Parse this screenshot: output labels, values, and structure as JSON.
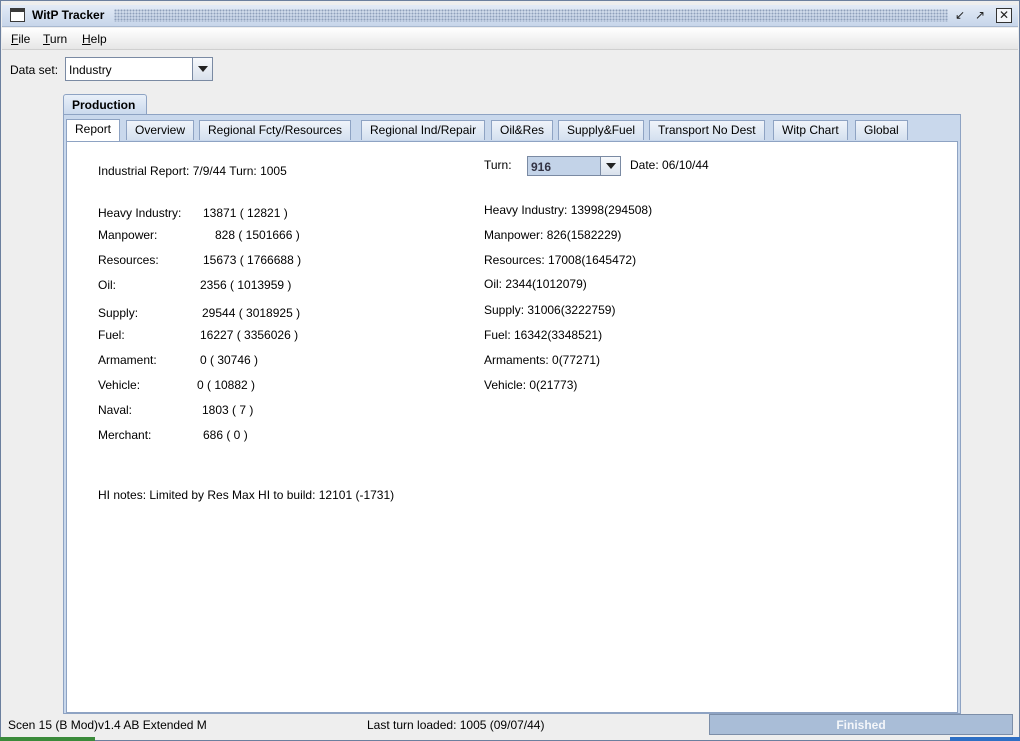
{
  "window": {
    "title": "WitP Tracker"
  },
  "menu": {
    "file": "File",
    "turn": "Turn",
    "help": "Help"
  },
  "dataset": {
    "label": "Data set:",
    "value": "Industry"
  },
  "outer_tab": {
    "label": "Production"
  },
  "tabs": [
    {
      "label": "Report",
      "active": true
    },
    {
      "label": "Overview"
    },
    {
      "label": "Regional Fcty/Resources"
    },
    {
      "label": "Regional Ind/Repair"
    },
    {
      "label": "Oil&Res"
    },
    {
      "label": "Supply&Fuel"
    },
    {
      "label": "Transport No Dest"
    },
    {
      "label": "Witp Chart"
    },
    {
      "label": "Global"
    }
  ],
  "report": {
    "header": "Industrial Report: 7/9/44  Turn: 1005",
    "rows": [
      {
        "label": "Heavy Industry:",
        "value": "13871 ( 12821 )"
      },
      {
        "label": "Manpower:",
        "value": "828 ( 1501666 )"
      },
      {
        "label": "Resources:",
        "value": "15673 ( 1766688 )"
      },
      {
        "label": "Oil:",
        "value": "2356 ( 1013959 )"
      },
      {
        "label": "Supply:",
        "value": "29544 ( 3018925 )"
      },
      {
        "label": "Fuel:",
        "value": "16227 ( 3356026 )"
      },
      {
        "label": "Armament:",
        "value": "0 ( 30746 )"
      },
      {
        "label": "Vehicle:",
        "value": "0 ( 10882 )"
      },
      {
        "label": "Naval:",
        "value": "1803 ( 7 )"
      },
      {
        "label": "Merchant:",
        "value": "686 ( 0 )"
      }
    ],
    "notes": "HI notes: Limited by Res  Max HI to build: 12101  (-1731)"
  },
  "compare": {
    "turn_label": "Turn:",
    "turn_value": "916",
    "date": "Date: 06/10/44",
    "rows": [
      "Heavy Industry: 13998(294508)",
      "Manpower: 826(1582229)",
      "Resources: 17008(1645472)",
      "Oil: 2344(1012079)",
      "Supply: 31006(3222759)",
      "Fuel: 16342(3348521)",
      "Armaments: 0(77271)",
      "Vehicle: 0(21773)"
    ]
  },
  "status": {
    "scenario": "Scen 15 (B Mod)v1.4 AB Extended M",
    "last_turn": "Last turn loaded: 1005 (09/07/44)",
    "progress_text": "Finished",
    "progress": 1.0
  }
}
